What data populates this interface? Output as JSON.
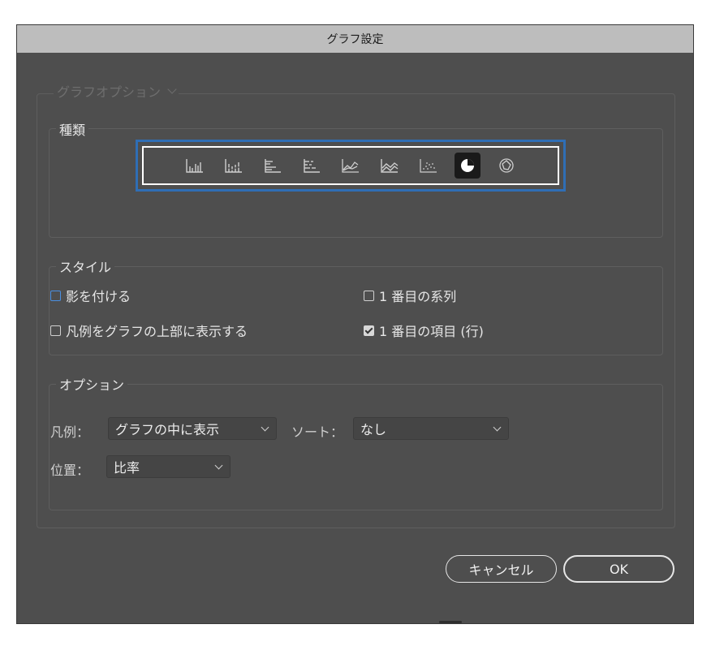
{
  "window": {
    "title": "グラフ設定"
  },
  "graph_options_menu": {
    "label": "グラフオプション"
  },
  "chart_type": {
    "legend": "種類",
    "types": [
      {
        "icon": "column-graph-icon"
      },
      {
        "icon": "stacked-column-graph-icon"
      },
      {
        "icon": "bar-graph-icon"
      },
      {
        "icon": "stacked-bar-graph-icon"
      },
      {
        "icon": "line-graph-icon"
      },
      {
        "icon": "area-graph-icon"
      },
      {
        "icon": "scatter-graph-icon"
      },
      {
        "icon": "pie-graph-icon",
        "selected": true
      },
      {
        "icon": "radar-graph-icon"
      }
    ]
  },
  "style": {
    "legend": "スタイル",
    "add_drop_shadow": {
      "label": "影を付ける",
      "checked": false
    },
    "legend_on_top": {
      "label": "凡例をグラフの上部に表示する",
      "checked": false
    },
    "first_row_in_front": {
      "label": "1 番目の系列",
      "checked": false
    },
    "first_column_in_front": {
      "label": "1 番目の項目 (行)",
      "checked": true
    }
  },
  "options": {
    "legend": "オプション",
    "legend_field": {
      "label": "凡例：",
      "value": "グラフの中に表示"
    },
    "sort_field": {
      "label": "ソート：",
      "value": "なし"
    },
    "position_field": {
      "label": "位置：",
      "value": "比率"
    }
  },
  "buttons": {
    "cancel": "キャンセル",
    "ok": "OK"
  },
  "colors": {
    "dialog_bg": "#4e4e4e",
    "titlebar_bg": "#bdbdbd",
    "focus_ring": "#2f6eb5",
    "selected_type_bg": "#1a1a1a"
  }
}
